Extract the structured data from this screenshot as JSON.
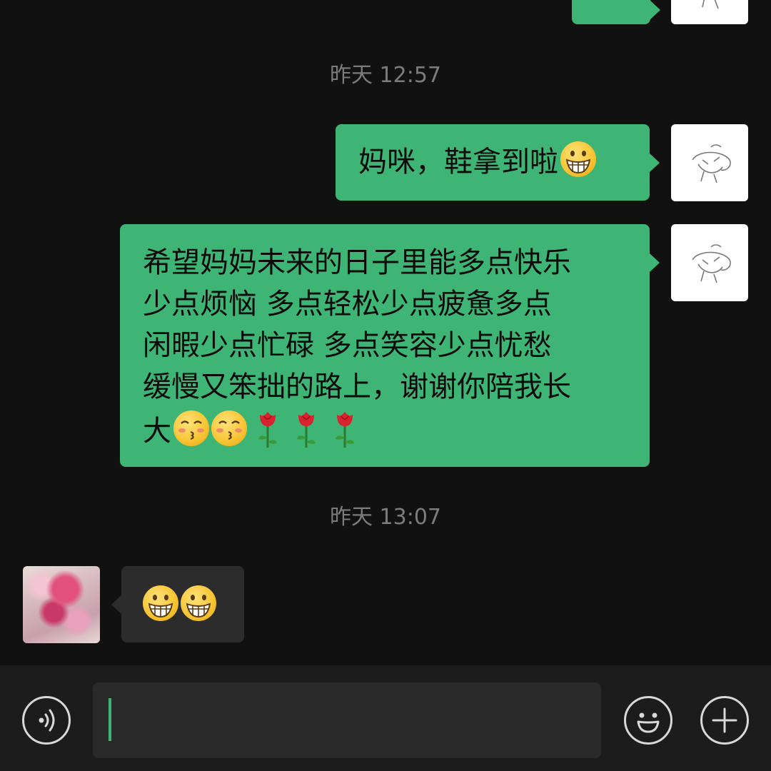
{
  "chat": {
    "timestamps": [
      "昨天 12:57",
      "昨天 13:07"
    ],
    "messages": [
      {
        "sender": "self",
        "text": "妈咪，鞋拿到啦",
        "emojis": [
          "grinning-face"
        ]
      },
      {
        "sender": "self",
        "text": "希望妈妈未来的日子里能多点快乐\n少点烦恼 多点轻松少点疲惫多点\n闲暇少点忙碌 多点笑容少点忧愁\n缓慢又笨拙的路上，谢谢你陪我长\n大",
        "emojis": [
          "kissing-face",
          "kissing-face",
          "rose",
          "rose",
          "rose"
        ]
      },
      {
        "sender": "other",
        "text": "",
        "emojis": [
          "grinning-face",
          "grinning-face"
        ]
      }
    ]
  },
  "input": {
    "value": ""
  },
  "icons": {
    "voice": "voice-icon",
    "emoji": "emoji-icon",
    "add": "plus-icon"
  },
  "colors": {
    "background": "#111111",
    "bubble_self": "#3eb575",
    "bubble_other": "#2c2c2c",
    "timestamp": "#7c7c7c"
  }
}
